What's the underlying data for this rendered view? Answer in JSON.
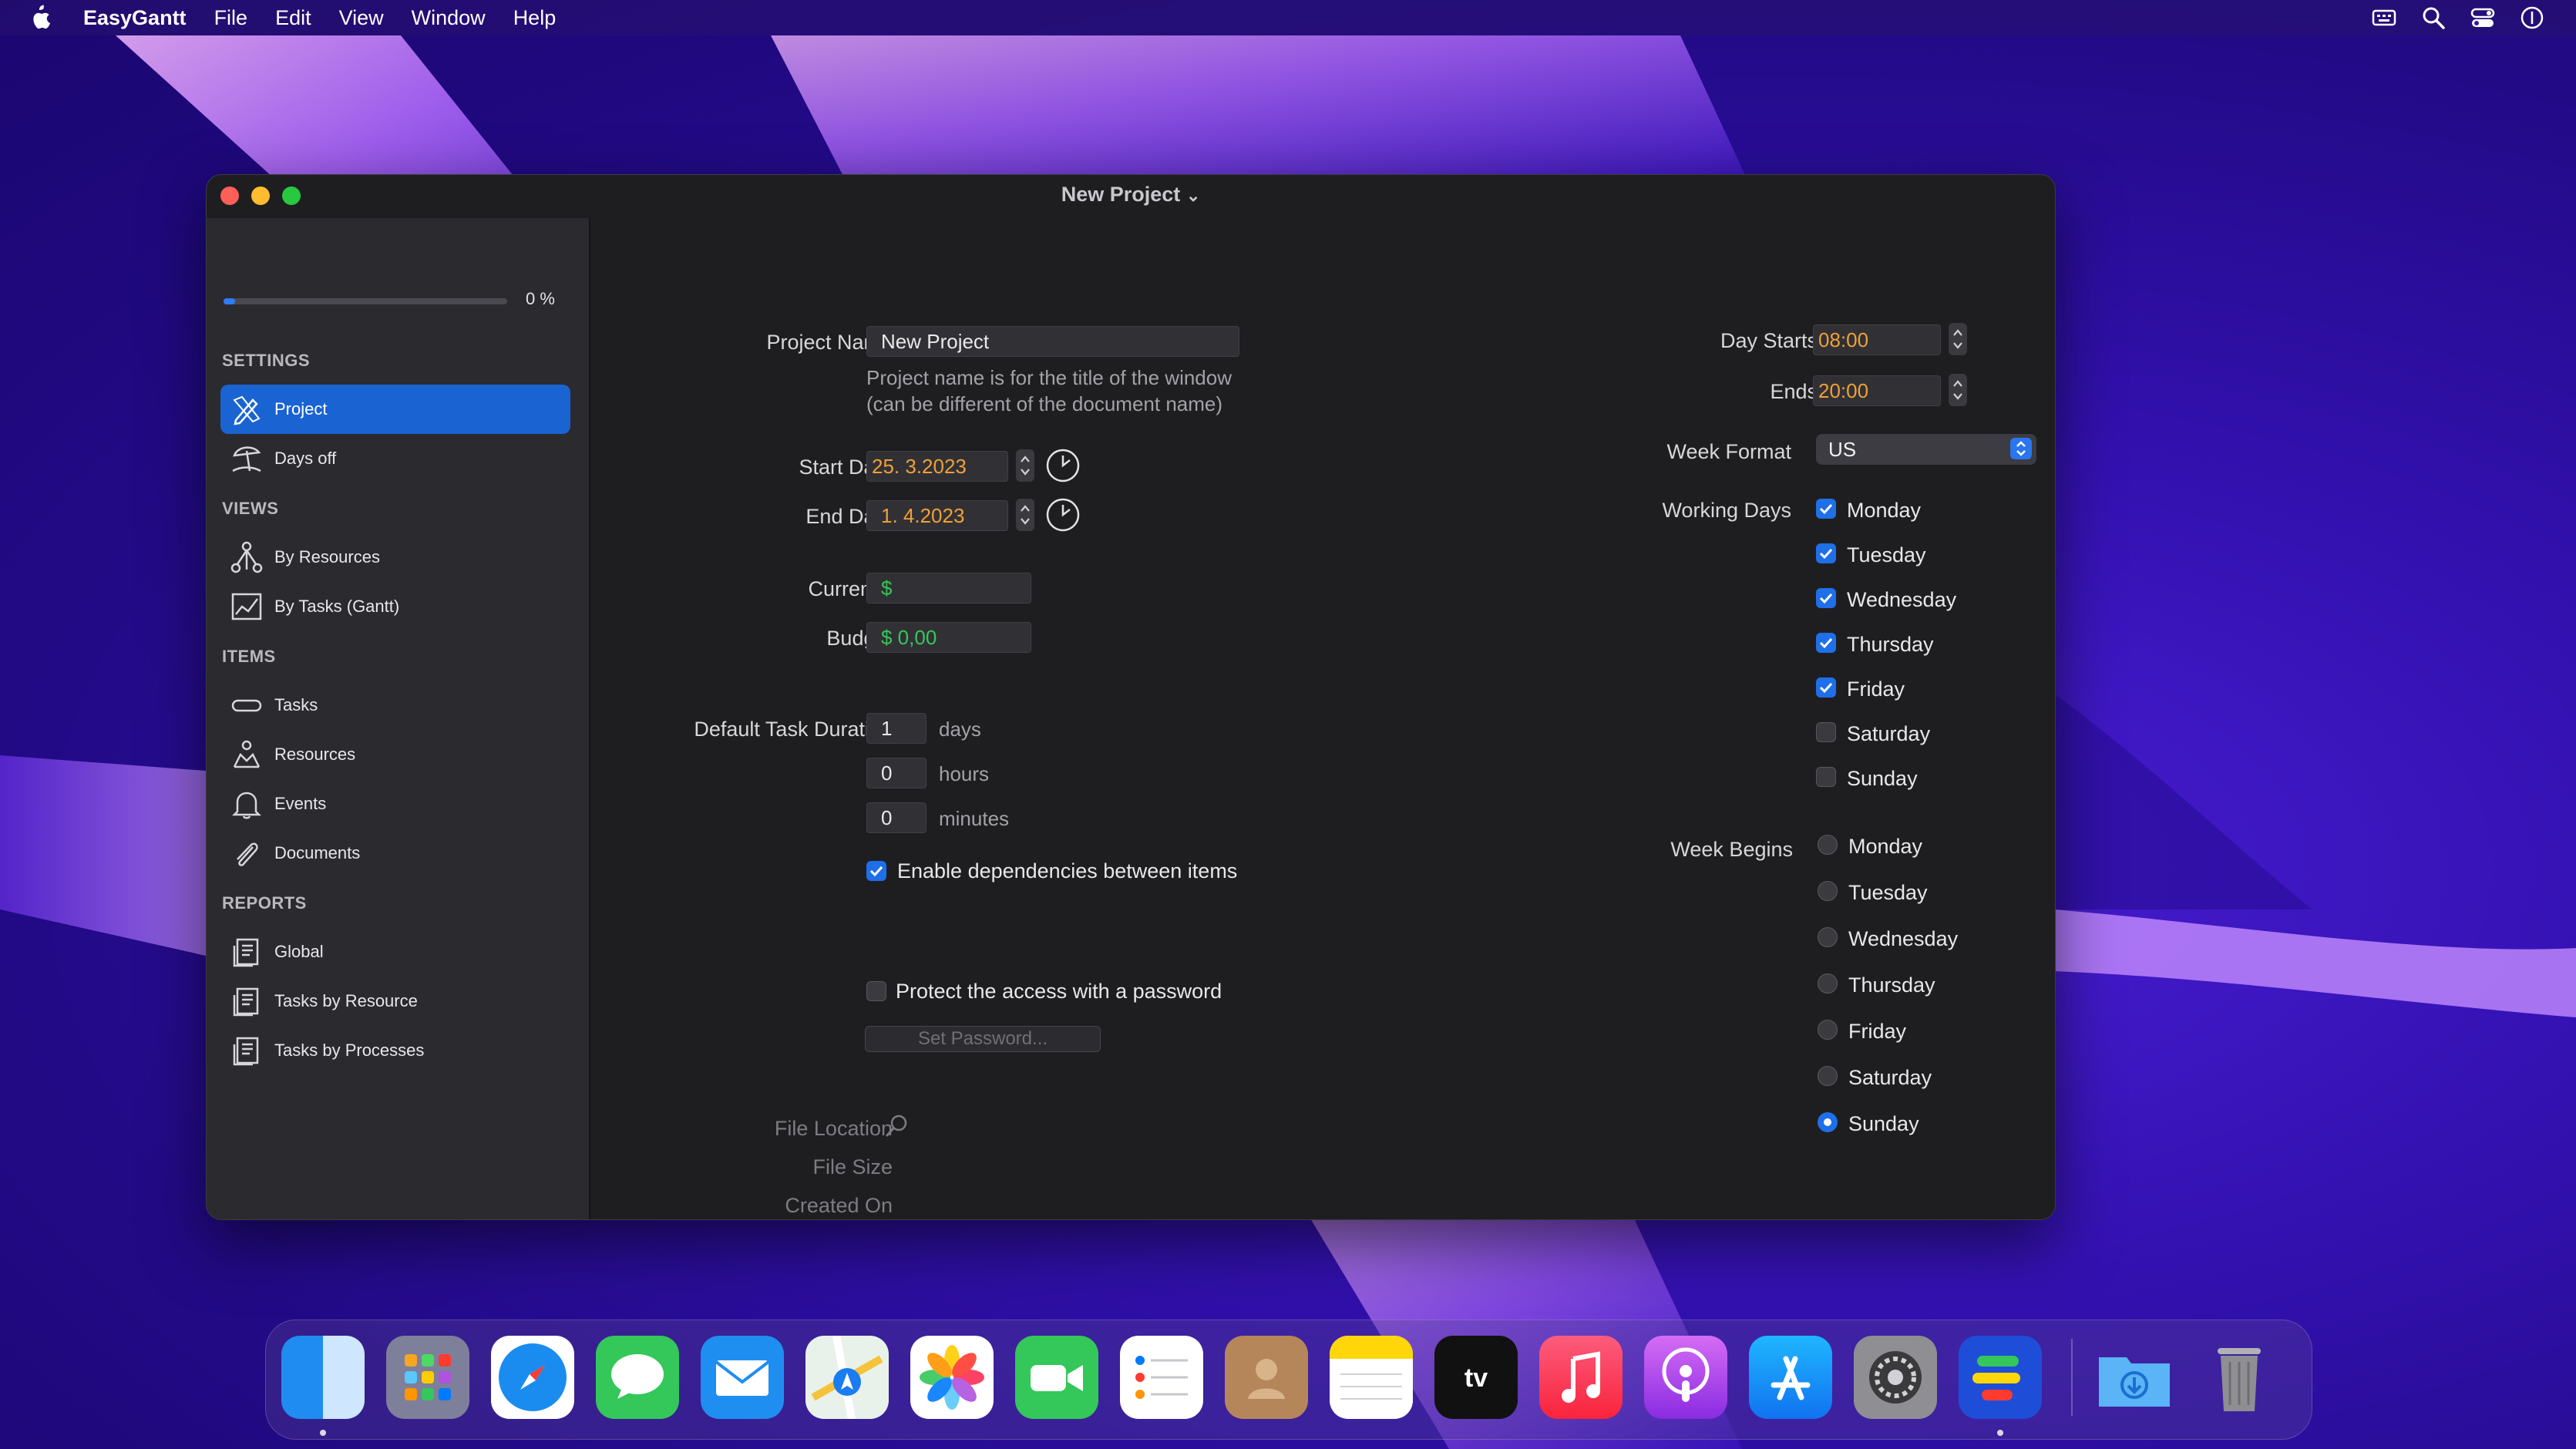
{
  "menubar": {
    "app_name": "EasyGantt",
    "items": [
      "File",
      "Edit",
      "View",
      "Window",
      "Help"
    ],
    "right_icons": [
      "keyboard-icon",
      "search-icon",
      "control-center-icon",
      "siri-icon"
    ]
  },
  "window": {
    "title": "New Project",
    "title_chevron": "⌄"
  },
  "sidebar": {
    "progress_percent": 4,
    "progress_label": "0 %",
    "sections": {
      "settings": "SETTINGS",
      "views": "VIEWS",
      "items": "ITEMS",
      "reports": "REPORTS"
    },
    "settings_items": [
      {
        "label": "Project",
        "icon": "pencil-ruler-icon",
        "selected": true
      },
      {
        "label": "Days off",
        "icon": "beach-umbrella-icon"
      }
    ],
    "views_items": [
      {
        "label": "By Resources",
        "icon": "resource-tree-icon"
      },
      {
        "label": "By Tasks (Gantt)",
        "icon": "gantt-chart-icon"
      }
    ],
    "items_items": [
      {
        "label": "Tasks",
        "icon": "task-pill-icon"
      },
      {
        "label": "Resources",
        "icon": "resources-icon"
      },
      {
        "label": "Events",
        "icon": "bell-icon"
      },
      {
        "label": "Documents",
        "icon": "paperclip-icon"
      }
    ],
    "reports_items": [
      {
        "label": "Global",
        "icon": "report-icon"
      },
      {
        "label": "Tasks by Resource",
        "icon": "report-icon"
      },
      {
        "label": "Tasks by Processes",
        "icon": "report-icon"
      }
    ]
  },
  "form": {
    "project_name_label": "Project Name",
    "project_name_value": "New Project",
    "project_name_note_1": "Project name is for the title of the window",
    "project_name_note_2": "(can be different of the document name)",
    "start_date_label": "Start Date",
    "start_date_value": "25.  3.2023",
    "end_date_label": "End Date",
    "end_date_value": "1.  4.2023",
    "currency_label": "Currency",
    "currency_value": "$",
    "budget_label": "Budget",
    "budget_value": "$ 0,00",
    "default_duration_label": "Default Task Duration",
    "duration_days_value": "1",
    "duration_days_unit": "days",
    "duration_hours_value": "0",
    "duration_hours_unit": "hours",
    "duration_minutes_value": "0",
    "duration_minutes_unit": "minutes",
    "enable_dependencies_label": "Enable dependencies between items",
    "enable_dependencies_checked": true,
    "protect_password_label": "Protect the access with a password",
    "protect_password_checked": false,
    "set_password_button": "Set Password...",
    "file_location_label": "File Location",
    "file_size_label": "File Size",
    "created_on_label": "Created On"
  },
  "schedule": {
    "day_starts_label": "Day Starts",
    "day_starts_value": "08:00",
    "ends_label": "Ends",
    "ends_value": "20:00",
    "week_format_label": "Week Format",
    "week_format_value": "US",
    "working_days_label": "Working Days",
    "working_days": [
      {
        "day": "Monday",
        "checked": true
      },
      {
        "day": "Tuesday",
        "checked": true
      },
      {
        "day": "Wednesday",
        "checked": true
      },
      {
        "day": "Thursday",
        "checked": true
      },
      {
        "day": "Friday",
        "checked": true
      },
      {
        "day": "Saturday",
        "checked": false
      },
      {
        "day": "Sunday",
        "checked": false
      }
    ],
    "week_begins_label": "Week Begins",
    "week_begins": [
      {
        "day": "Monday",
        "selected": false
      },
      {
        "day": "Tuesday",
        "selected": false
      },
      {
        "day": "Wednesday",
        "selected": false
      },
      {
        "day": "Thursday",
        "selected": false
      },
      {
        "day": "Friday",
        "selected": false
      },
      {
        "day": "Saturday",
        "selected": false
      },
      {
        "day": "Sunday",
        "selected": true
      }
    ]
  },
  "dock": {
    "apps": [
      "Finder",
      "Launchpad",
      "Safari",
      "Messages",
      "Mail",
      "Maps",
      "Photos",
      "FaceTime",
      "Reminders",
      "Contacts",
      "Notes",
      "TV",
      "Music",
      "Podcasts",
      "App Store",
      "System Settings",
      "EasyGantt",
      "Downloads",
      "Trash"
    ]
  },
  "colors": {
    "accent": "#1f6fe8",
    "selection": "#1a63d2",
    "time_value": "#f0a037",
    "money_value": "#35c759"
  }
}
